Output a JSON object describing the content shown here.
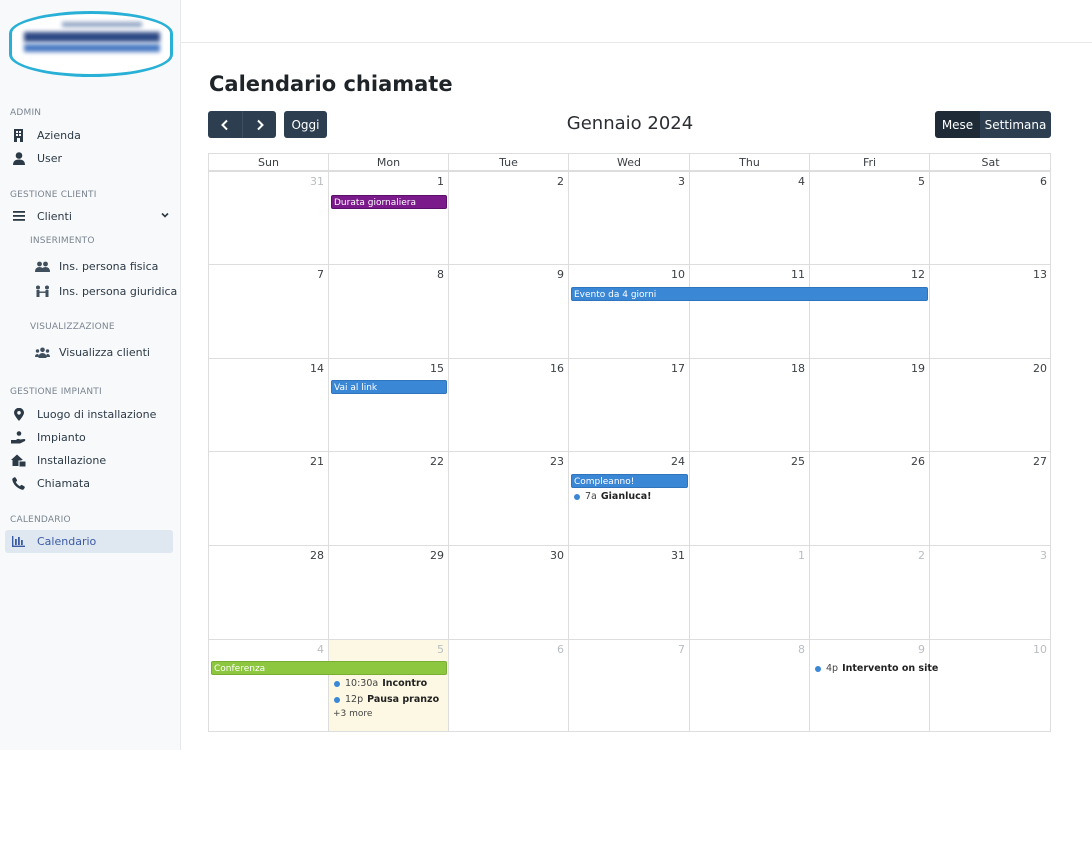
{
  "sidebar": {
    "sections": {
      "admin": "ADMIN",
      "gestione_clienti": "GESTIONE CLIENTI",
      "inserimento": "INSERIMENTO",
      "visualizzazione": "VISUALIZZAZIONE",
      "gestione_impianti": "GESTIONE IMPIANTI",
      "calendario": "CALENDARIO"
    },
    "items": {
      "azienda": "Azienda",
      "user": "User",
      "clienti": "Clienti",
      "ins_fisica": "Ins. persona fisica",
      "ins_giuridica": "Ins. persona giuridica",
      "visualizza_clienti": "Visualizza clienti",
      "luogo": "Luogo di installazione",
      "impianto": "Impianto",
      "installazione": "Installazione",
      "chiamata": "Chiamata",
      "calendario": "Calendario"
    },
    "icons": [
      "building-icon",
      "user-icon",
      "menu-icon",
      "users-icon",
      "users-link-icon",
      "group-icon",
      "map-pin-icon",
      "hand-icon",
      "house-icon",
      "phone-icon",
      "chart-bar-icon",
      "chevron-down-icon"
    ]
  },
  "page": {
    "title": "Calendario chiamate"
  },
  "toolbar": {
    "today": "Oggi",
    "title": "Gennaio 2024",
    "month": "Mese",
    "week": "Settimana"
  },
  "calendar": {
    "dow": [
      "Sun",
      "Mon",
      "Tue",
      "Wed",
      "Thu",
      "Fri",
      "Sat"
    ],
    "weeks": [
      [
        "31",
        "1",
        "2",
        "3",
        "4",
        "5",
        "6"
      ],
      [
        "7",
        "8",
        "9",
        "10",
        "11",
        "12",
        "13"
      ],
      [
        "14",
        "15",
        "16",
        "17",
        "18",
        "19",
        "20"
      ],
      [
        "21",
        "22",
        "23",
        "24",
        "25",
        "26",
        "27"
      ],
      [
        "28",
        "29",
        "30",
        "31",
        "1",
        "2",
        "3"
      ],
      [
        "4",
        "5",
        "6",
        "7",
        "8",
        "9",
        "10"
      ]
    ],
    "events": {
      "durata": "Durata giornaliera",
      "quattro_giorni": "Evento da 4 giorni",
      "link": "Vai al link",
      "compleanno": "Compleanno!",
      "gianluca_time": "7a",
      "gianluca_title": "Gianluca!",
      "conferenza": "Conferenza",
      "incontro_time": "10:30a",
      "incontro_title": "Incontro",
      "pranzo_time": "12p",
      "pranzo_title": "Pausa pranzo",
      "more": "+3 more",
      "intervento_time": "4p",
      "intervento_title": "Intervento on site"
    }
  },
  "colors": {
    "primary_button": "#2c3e50",
    "event_purple": "#7b1a8b",
    "event_blue": "#3a87d6",
    "event_green": "#8dc63f",
    "today_bg": "#fcf8e3",
    "active_nav": "#3b5ba5"
  }
}
